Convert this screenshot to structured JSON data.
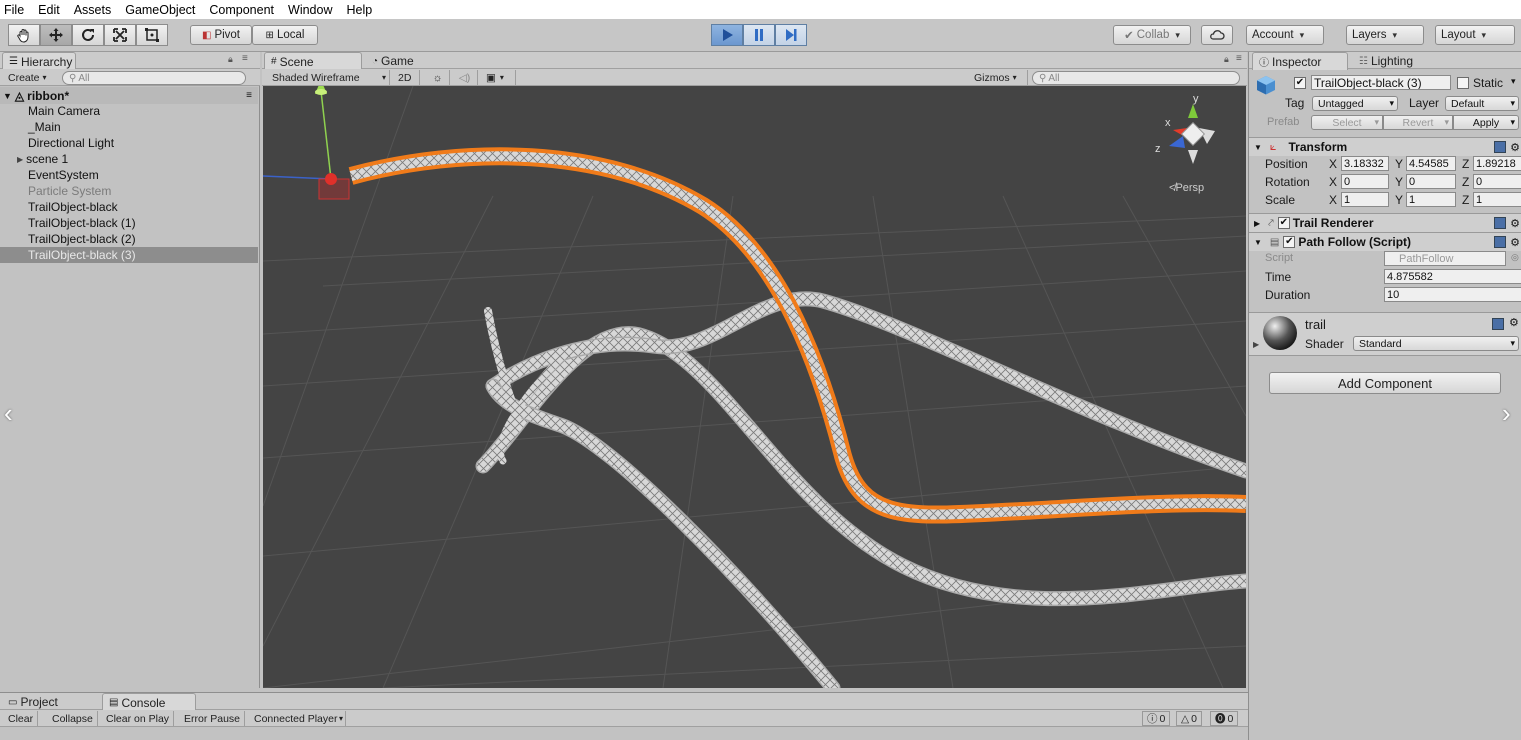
{
  "menu": [
    "File",
    "Edit",
    "Assets",
    "GameObject",
    "Component",
    "Window",
    "Help"
  ],
  "toolbar": {
    "pivot": "Pivot",
    "local": "Local",
    "collab": "Collab",
    "account": "Account",
    "layers": "Layers",
    "layout": "Layout"
  },
  "hierarchy": {
    "tab": "Hierarchy",
    "create": "Create",
    "search_placeholder": "All",
    "scene_name": "ribbon*",
    "items": [
      "Main Camera",
      "_Main",
      "Directional Light",
      "scene 1",
      "EventSystem",
      "Particle System",
      "TrailObject-black",
      "TrailObject-black (1)",
      "TrailObject-black (2)",
      "TrailObject-black (3)"
    ]
  },
  "scene_view": {
    "tab_scene": "Scene",
    "tab_game": "Game",
    "draw_mode": "Shaded Wireframe",
    "mode_2d": "2D",
    "gizmos": "Gizmos",
    "search_placeholder": "All",
    "persp_label": "Persp",
    "axis_x": "x",
    "axis_y": "y",
    "axis_z": "z"
  },
  "inspector": {
    "tab_inspector": "Inspector",
    "tab_lighting": "Lighting",
    "object_name": "TrailObject-black (3)",
    "static_label": "Static",
    "tag_label": "Tag",
    "tag_value": "Untagged",
    "layer_label": "Layer",
    "layer_value": "Default",
    "prefab_label": "Prefab",
    "prefab_select": "Select",
    "prefab_revert": "Revert",
    "prefab_apply": "Apply",
    "transform": {
      "title": "Transform",
      "position_label": "Position",
      "rotation_label": "Rotation",
      "scale_label": "Scale",
      "px": "3.18332",
      "py": "4.54585",
      "pz": "1.89218",
      "rx": "0",
      "ry": "0",
      "rz": "0",
      "sx": "1",
      "sy": "1",
      "sz": "1"
    },
    "trail_renderer": "Trail Renderer",
    "path_follow": {
      "title": "Path Follow (Script)",
      "script_label": "Script",
      "script_value": "PathFollow",
      "time_label": "Time",
      "time_value": "4.875582",
      "duration_label": "Duration",
      "duration_value": "10"
    },
    "material": {
      "name": "trail",
      "shader_label": "Shader",
      "shader_value": "Standard"
    },
    "add_component": "Add Component"
  },
  "bottom": {
    "tab_project": "Project",
    "tab_console": "Console",
    "clear": "Clear",
    "collapse": "Collapse",
    "clear_on_play": "Clear on Play",
    "error_pause": "Error Pause",
    "connected_player": "Connected Player",
    "count_info": "0",
    "count_warn": "0",
    "count_error": "0"
  },
  "colors": {
    "selection_orange": "#f07b1a",
    "scene_bg": "#444444",
    "play_blue": "#2f6cc4"
  }
}
